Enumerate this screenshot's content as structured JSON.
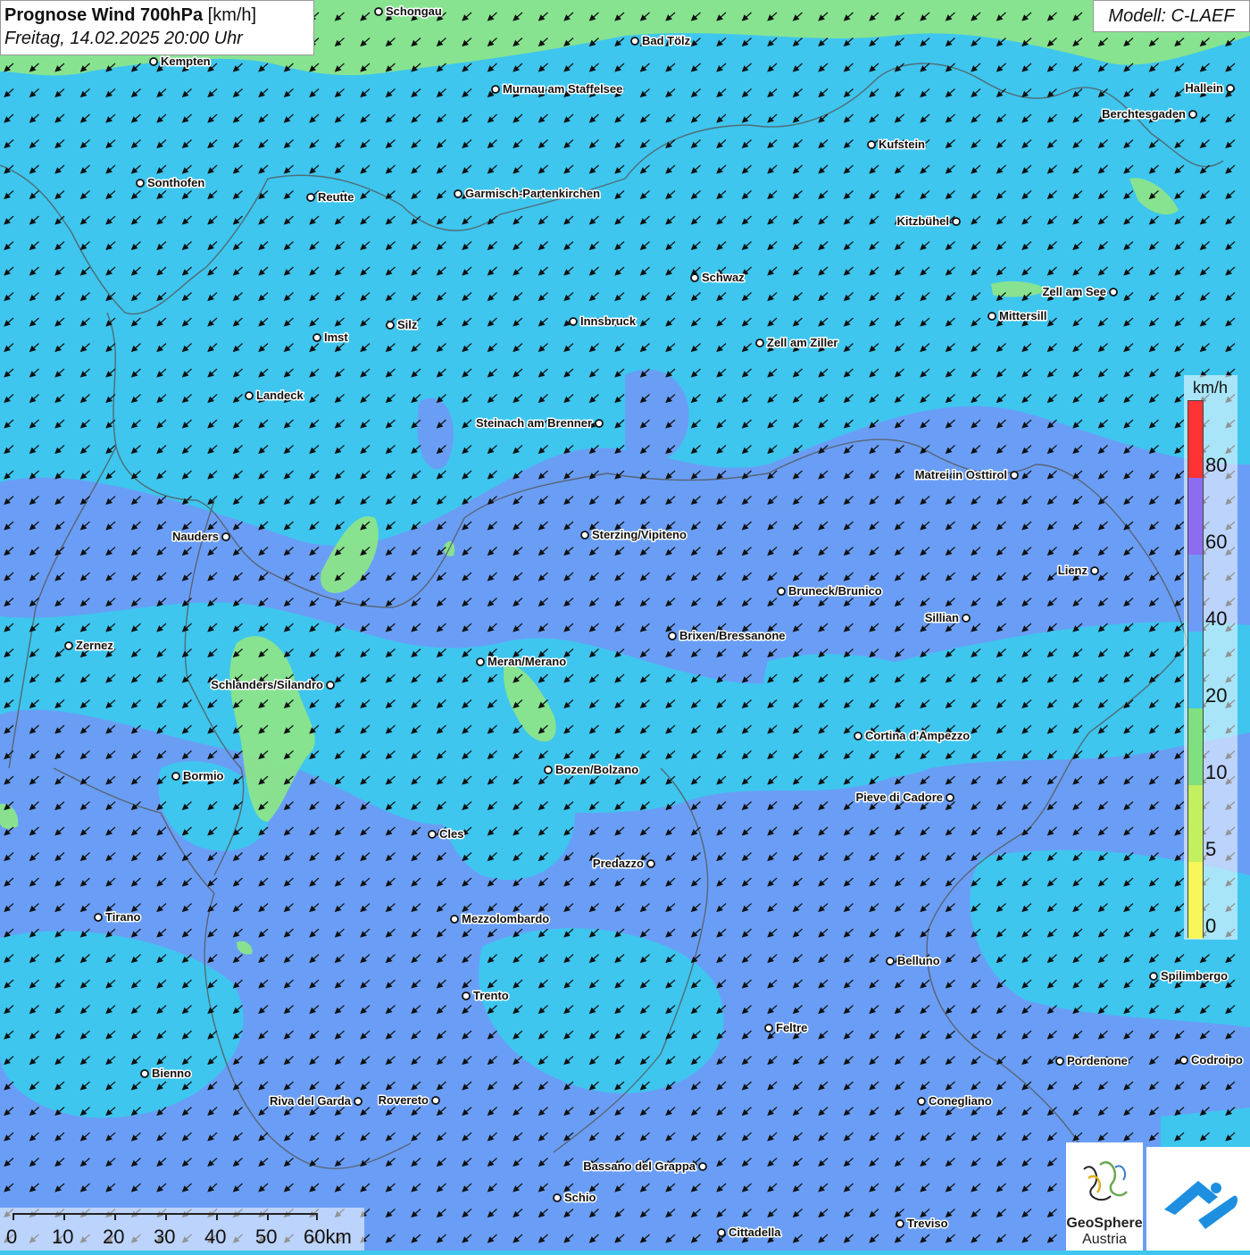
{
  "title": {
    "main": "Prognose Wind 700hPa",
    "unit": "[km/h]",
    "datetime": "Freitag, 14.02.2025 20:00 Uhr"
  },
  "model_label": "Modell: C-LAEF",
  "legend": {
    "unit": "km/h",
    "ticks": [
      "80",
      "60",
      "40",
      "20",
      "10",
      "5",
      "0"
    ],
    "colors": [
      "#ff3333",
      "#8c6cf0",
      "#6d9cf6",
      "#3ec6ef",
      "#7fe07f",
      "#c2f060",
      "#f7f75a"
    ]
  },
  "scale_bar": {
    "labels": [
      "0",
      "10",
      "20",
      "30",
      "40",
      "50",
      "60km"
    ]
  },
  "logo": {
    "name_line1": "GeoSphere",
    "name_line2": "Austria"
  },
  "map_colors": {
    "band_20_40": "#3ec6ef",
    "band_40_60": "#6d9cf6",
    "band_10_20": "#8be58a",
    "arrow": "#111111"
  },
  "cities": [
    {
      "name": "Schongau"
    },
    {
      "name": "Bad Tölz"
    },
    {
      "name": "Kempten"
    },
    {
      "name": "Murnau am Staffelsee"
    },
    {
      "name": "Hallein"
    },
    {
      "name": "Berchtesgaden"
    },
    {
      "name": "Kufstein"
    },
    {
      "name": "Sonthofen"
    },
    {
      "name": "Reutte"
    },
    {
      "name": "Garmisch-Partenkirchen"
    },
    {
      "name": "Kitzbühel"
    },
    {
      "name": "Schwaz"
    },
    {
      "name": "Zell am See"
    },
    {
      "name": "Mittersill"
    },
    {
      "name": "Silz"
    },
    {
      "name": "Innsbruck"
    },
    {
      "name": "Imst"
    },
    {
      "name": "Zell am Ziller"
    },
    {
      "name": "Landeck"
    },
    {
      "name": "Steinach am Brenner"
    },
    {
      "name": "Matrei in Osttirol"
    },
    {
      "name": "Nauders"
    },
    {
      "name": "Sterzing/Vipiteno"
    },
    {
      "name": "Lienz"
    },
    {
      "name": "Bruneck/Brunico"
    },
    {
      "name": "Sillian"
    },
    {
      "name": "Brixen/Bressanone"
    },
    {
      "name": "Zernez"
    },
    {
      "name": "Meran/Merano"
    },
    {
      "name": "Schlanders/Silandro"
    },
    {
      "name": "Cortina d'Ampezzo"
    },
    {
      "name": "Bozen/Bolzano"
    },
    {
      "name": "Bormio"
    },
    {
      "name": "Pieve di Cadore"
    },
    {
      "name": "Cles"
    },
    {
      "name": "Predazzo"
    },
    {
      "name": "Tirano"
    },
    {
      "name": "Mezzolombardo"
    },
    {
      "name": "Belluno"
    },
    {
      "name": "Spilimbergo"
    },
    {
      "name": "Trento"
    },
    {
      "name": "Feltre"
    },
    {
      "name": "Bienno"
    },
    {
      "name": "Pordenone"
    },
    {
      "name": "Codroipo"
    },
    {
      "name": "Riva del Garda"
    },
    {
      "name": "Rovereto"
    },
    {
      "name": "Conegliano"
    },
    {
      "name": "Bassano del Grappa"
    },
    {
      "name": "Schio"
    },
    {
      "name": "Treviso"
    },
    {
      "name": "Cittadella"
    }
  ]
}
